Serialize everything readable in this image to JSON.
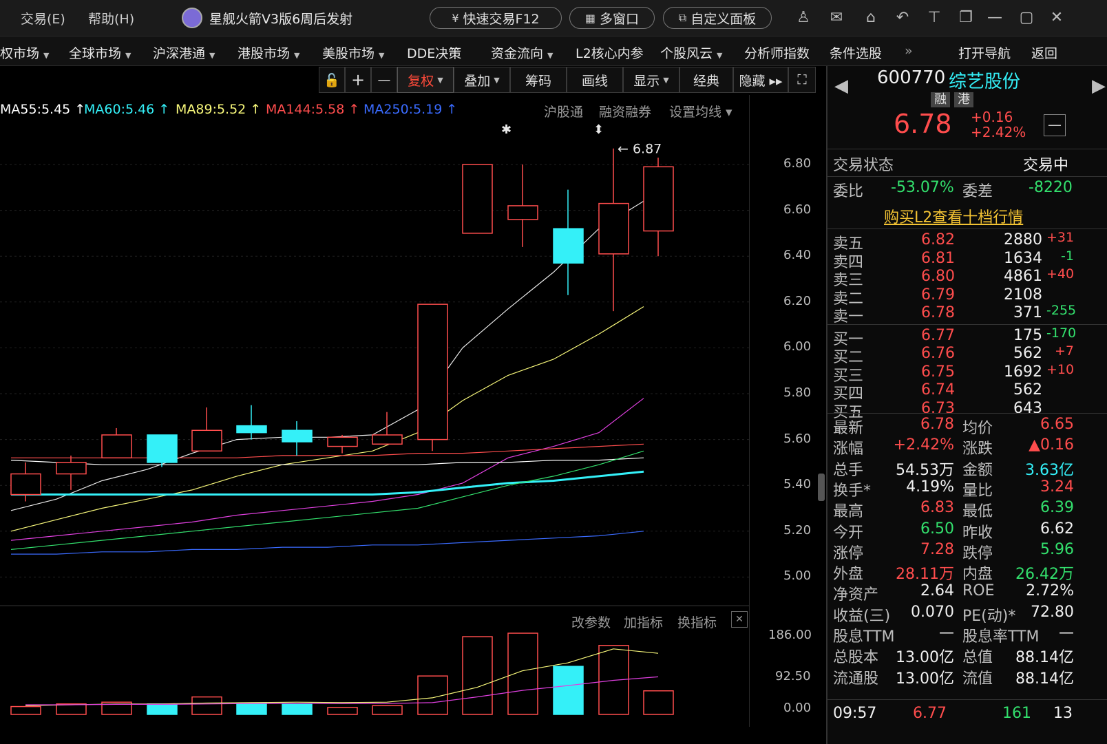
{
  "menu": {
    "trade": "交易(E)",
    "help": "帮助(H)"
  },
  "news": {
    "headline": "星舰火箭V3版6周后发射"
  },
  "top_buttons": {
    "quick_trade": "快速交易F12",
    "multi_window": "多窗口",
    "custom_panel": "自定义面板"
  },
  "nav": [
    {
      "label": "权市场",
      "caret": true
    },
    {
      "label": "全球市场",
      "caret": true
    },
    {
      "label": "沪深港通",
      "caret": true
    },
    {
      "label": "港股市场",
      "caret": true
    },
    {
      "label": "美股市场",
      "caret": true
    },
    {
      "label": "DDE决策",
      "caret": false
    },
    {
      "label": "资金流向",
      "caret": true
    },
    {
      "label": "L2核心内参",
      "caret": false
    },
    {
      "label": "个股风云",
      "caret": true
    },
    {
      "label": "分析师指数",
      "caret": false
    },
    {
      "label": "条件选股",
      "caret": false
    },
    {
      "label": "»",
      "caret": false
    },
    {
      "label": "打开导航",
      "caret": false
    },
    {
      "label": "返回",
      "caret": false
    }
  ],
  "toolbar": {
    "lock": "🔓",
    "plus": "+",
    "minus": "—",
    "fuquan": "复权",
    "overlay": "叠加",
    "chips": "筹码",
    "draw": "画线",
    "display": "显示",
    "classic": "经典",
    "hide": "隐藏 ▸▸",
    "fullscreen": "⛶"
  },
  "ma_legend": [
    {
      "text": "MA55:5.45 ↑",
      "color": "#ffffff"
    },
    {
      "text": "MA60:5.46 ↑",
      "color": "#34f0f8"
    },
    {
      "text": "MA89:5.52 ↑",
      "color": "#f7f77a"
    },
    {
      "text": "MA144:5.58 ↑",
      "color": "#ff4d4d"
    },
    {
      "text": "MA250:5.19 ↑",
      "color": "#3a6bff"
    }
  ],
  "chart_links": {
    "hsgt": "沪股通",
    "margin": "融资融券",
    "set_ma": "设置均线"
  },
  "price_axis": [
    "6.80",
    "6.60",
    "6.40",
    "6.20",
    "6.00",
    "5.80",
    "5.60",
    "5.40",
    "5.20",
    "5.00"
  ],
  "high_marker": "6.87",
  "volume_links": {
    "params": "改参数",
    "add_indicator": "加指标",
    "switch_indicator": "换指标",
    "close": "✕"
  },
  "volume_axis": [
    "186.00",
    "92.50",
    "0.00"
  ],
  "chart_data": {
    "type": "candlestick",
    "ylim": [
      5.0,
      6.9
    ],
    "candles": [
      {
        "o": 5.36,
        "c": 5.45,
        "h": 5.5,
        "l": 5.33,
        "up": true
      },
      {
        "o": 5.45,
        "c": 5.5,
        "h": 5.53,
        "l": 5.38,
        "up": true
      },
      {
        "o": 5.52,
        "c": 5.62,
        "h": 5.65,
        "l": 5.52,
        "up": true
      },
      {
        "o": 5.62,
        "c": 5.5,
        "h": 5.62,
        "l": 5.48,
        "up": false
      },
      {
        "o": 5.55,
        "c": 5.64,
        "h": 5.74,
        "l": 5.55,
        "up": true
      },
      {
        "o": 5.66,
        "c": 5.63,
        "h": 5.75,
        "l": 5.6,
        "up": false
      },
      {
        "o": 5.64,
        "c": 5.59,
        "h": 5.68,
        "l": 5.53,
        "up": false
      },
      {
        "o": 5.57,
        "c": 5.61,
        "h": 5.62,
        "l": 5.54,
        "up": true
      },
      {
        "o": 5.58,
        "c": 5.62,
        "h": 5.72,
        "l": 5.58,
        "up": true
      },
      {
        "o": 5.6,
        "c": 6.19,
        "h": 6.19,
        "l": 5.55,
        "up": true
      },
      {
        "o": 6.5,
        "c": 6.8,
        "h": 6.8,
        "l": 6.5,
        "up": true
      },
      {
        "o": 6.56,
        "c": 6.62,
        "h": 6.8,
        "l": 6.44,
        "up": true
      },
      {
        "o": 6.52,
        "c": 6.37,
        "h": 6.69,
        "l": 6.23,
        "up": false
      },
      {
        "o": 6.41,
        "c": 6.63,
        "h": 6.87,
        "l": 6.16,
        "up": true
      },
      {
        "o": 6.51,
        "c": 6.79,
        "h": 6.83,
        "l": 6.4,
        "up": true
      }
    ],
    "ma_lines": [
      {
        "name": "MA5",
        "color": "#e8e8e8",
        "values": [
          5.29,
          5.34,
          5.42,
          5.47,
          5.54,
          5.6,
          5.61,
          5.61,
          5.62,
          5.73,
          6.0,
          6.17,
          6.33,
          6.52,
          6.64
        ]
      },
      {
        "name": "MA10",
        "color": "#f7f77a",
        "values": [
          5.2,
          5.25,
          5.3,
          5.34,
          5.38,
          5.44,
          5.49,
          5.52,
          5.55,
          5.63,
          5.77,
          5.88,
          5.95,
          6.06,
          6.18
        ]
      },
      {
        "name": "MA20",
        "color": "#e040e0",
        "values": [
          5.16,
          5.18,
          5.2,
          5.22,
          5.24,
          5.27,
          5.29,
          5.31,
          5.33,
          5.36,
          5.41,
          5.52,
          5.57,
          5.63,
          5.78
        ]
      },
      {
        "name": "MA144",
        "color": "#ff4d4d",
        "values": [
          5.52,
          5.52,
          5.52,
          5.52,
          5.52,
          5.52,
          5.53,
          5.53,
          5.53,
          5.54,
          5.54,
          5.55,
          5.56,
          5.57,
          5.58
        ]
      },
      {
        "name": "MA55",
        "color": "#ffffff",
        "values": [
          5.51,
          5.5,
          5.49,
          5.49,
          5.49,
          5.49,
          5.49,
          5.49,
          5.49,
          5.49,
          5.5,
          5.5,
          5.51,
          5.51,
          5.52
        ]
      },
      {
        "name": "MA60",
        "color": "#34f0f8",
        "values": [
          5.36,
          5.36,
          5.36,
          5.36,
          5.36,
          5.36,
          5.36,
          5.36,
          5.36,
          5.37,
          5.39,
          5.41,
          5.42,
          5.44,
          5.46
        ]
      },
      {
        "name": "MA89",
        "color": "#33e06d",
        "values": [
          5.12,
          5.14,
          5.16,
          5.18,
          5.2,
          5.22,
          5.24,
          5.26,
          5.28,
          5.3,
          5.35,
          5.4,
          5.44,
          5.49,
          5.55
        ]
      },
      {
        "name": "MA250",
        "color": "#3a6bff",
        "values": [
          5.1,
          5.1,
          5.11,
          5.11,
          5.12,
          5.12,
          5.13,
          5.13,
          5.14,
          5.14,
          5.15,
          5.16,
          5.17,
          5.18,
          5.2
        ]
      }
    ],
    "volume": {
      "ylim": [
        0,
        186
      ],
      "values": [
        18,
        24,
        28,
        24,
        40,
        26,
        24,
        16,
        20,
        88,
        178,
        186,
        110,
        158,
        54
      ],
      "ma": [
        {
          "color": "#f7f77a",
          "values": [
            20,
            22,
            24,
            24,
            26,
            27,
            28,
            27,
            28,
            38,
            62,
            100,
            118,
            150,
            140
          ]
        },
        {
          "color": "#e040e0",
          "values": [
            22,
            22,
            23,
            23,
            24,
            25,
            25,
            25,
            25,
            27,
            40,
            55,
            66,
            78,
            86
          ]
        }
      ]
    }
  },
  "stock": {
    "code": "600770",
    "name": "综艺股份",
    "badge_rong": "融",
    "badge_gang": "港",
    "price": "6.78",
    "change": "+0.16",
    "change_pct": "+2.42%",
    "status_label": "交易状态",
    "status_value": "交易中",
    "weibi_label": "委比",
    "weibi": "-53.07%",
    "weicha_label": "委差",
    "weicha": "-8220",
    "l2_link": "购买L2查看十档行情"
  },
  "asks": [
    {
      "label": "卖五",
      "price": "6.82",
      "vol": "2880",
      "chg": "+31"
    },
    {
      "label": "卖四",
      "price": "6.81",
      "vol": "1634",
      "chg": "-1"
    },
    {
      "label": "卖三",
      "price": "6.80",
      "vol": "4861",
      "chg": "+40"
    },
    {
      "label": "卖二",
      "price": "6.79",
      "vol": "2108",
      "chg": ""
    },
    {
      "label": "卖一",
      "price": "6.78",
      "vol": "371",
      "chg": "-255"
    }
  ],
  "bids": [
    {
      "label": "买一",
      "price": "6.77",
      "vol": "175",
      "chg": "-170"
    },
    {
      "label": "买二",
      "price": "6.76",
      "vol": "562",
      "chg": "+7"
    },
    {
      "label": "买三",
      "price": "6.75",
      "vol": "1692",
      "chg": "+10"
    },
    {
      "label": "买四",
      "price": "6.74",
      "vol": "562",
      "chg": ""
    },
    {
      "label": "买五",
      "price": "6.73",
      "vol": "643",
      "chg": ""
    }
  ],
  "quote": [
    {
      "l1": "最新",
      "v1": "6.78",
      "c1": "red",
      "l2": "均价",
      "v2": "6.65",
      "c2": "red"
    },
    {
      "l1": "涨幅",
      "v1": "+2.42%",
      "c1": "red",
      "l2": "涨跌",
      "v2": "▲0.16",
      "c2": "red"
    },
    {
      "l1": "总手",
      "v1": "54.53万",
      "c1": "white",
      "l2": "金额",
      "v2": "3.63亿",
      "c2": "cyan"
    },
    {
      "l1": "换手*",
      "v1": "4.19%",
      "c1": "white",
      "l2": "量比",
      "v2": "3.24",
      "c2": "red"
    },
    {
      "l1": "最高",
      "v1": "6.83",
      "c1": "red",
      "l2": "最低",
      "v2": "6.39",
      "c2": "green"
    },
    {
      "l1": "今开",
      "v1": "6.50",
      "c1": "green",
      "l2": "昨收",
      "v2": "6.62",
      "c2": "white"
    },
    {
      "l1": "涨停",
      "v1": "7.28",
      "c1": "red",
      "l2": "跌停",
      "v2": "5.96",
      "c2": "green"
    },
    {
      "l1": "外盘",
      "v1": "28.11万",
      "c1": "red",
      "l2": "内盘",
      "v2": "26.42万",
      "c2": "green"
    },
    {
      "l1": "净资产",
      "v1": "2.64",
      "c1": "white",
      "l2": "ROE",
      "v2": "2.72%",
      "c2": "white"
    },
    {
      "l1": "收益(三)",
      "v1": "0.070",
      "c1": "white",
      "l2": "PE(动)*",
      "v2": "72.80",
      "c2": "white"
    },
    {
      "l1": "股息TTM",
      "v1": "—",
      "c1": "white",
      "l2": "股息率TTM",
      "v2": "—",
      "c2": "white"
    },
    {
      "l1": "总股本",
      "v1": "13.00亿",
      "c1": "white",
      "l2": "总值",
      "v2": "88.14亿",
      "c2": "white"
    },
    {
      "l1": "流通股",
      "v1": "13.00亿",
      "c1": "white",
      "l2": "流值",
      "v2": "88.14亿",
      "c2": "white"
    }
  ],
  "tick": {
    "time": "09:57",
    "price": "6.77",
    "vol": "161",
    "count": "13"
  },
  "colors": {
    "up": "#ff4d4d",
    "down": "#34f0f8",
    "bg": "#000000"
  }
}
